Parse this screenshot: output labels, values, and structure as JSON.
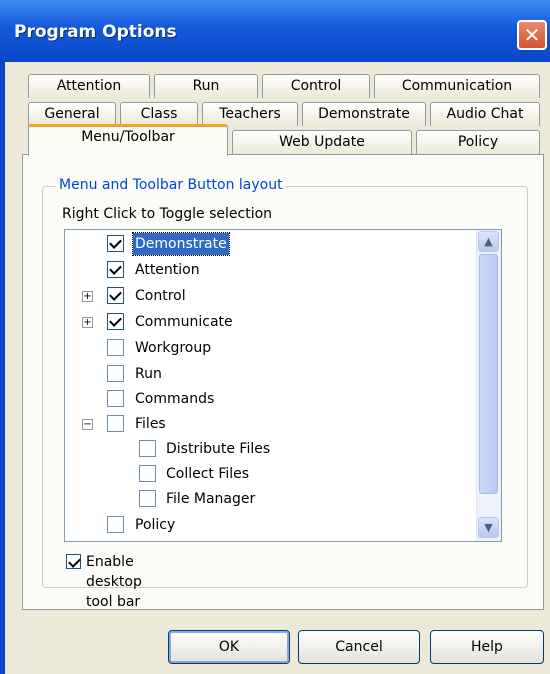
{
  "window": {
    "title": "Program Options",
    "close_label": "✕"
  },
  "tabs": {
    "row1": [
      "Attention",
      "Run",
      "Control",
      "Communication"
    ],
    "row2": [
      "General",
      "Class",
      "Teachers",
      "Demonstrate",
      "Audio Chat"
    ],
    "row3": [
      "Menu/Toolbar",
      "Web Update",
      "Policy"
    ],
    "active": "Menu/Toolbar"
  },
  "group": {
    "title": "Menu and Toolbar Button layout",
    "hint": "Right Click to Toggle selection"
  },
  "tree": [
    {
      "label": "Demonstrate",
      "checked": true,
      "selected": true,
      "expander": "",
      "level": 0
    },
    {
      "label": "Attention",
      "checked": true,
      "selected": false,
      "expander": "",
      "level": 0
    },
    {
      "label": "Control",
      "checked": true,
      "selected": false,
      "expander": "+",
      "level": 0
    },
    {
      "label": "Communicate",
      "checked": true,
      "selected": false,
      "expander": "+",
      "level": 0
    },
    {
      "label": "Workgroup",
      "checked": false,
      "selected": false,
      "expander": "",
      "level": 0
    },
    {
      "label": "Run",
      "checked": false,
      "selected": false,
      "expander": "",
      "level": 0
    },
    {
      "label": "Commands",
      "checked": false,
      "selected": false,
      "expander": "",
      "level": 0
    },
    {
      "label": "Files",
      "checked": false,
      "selected": false,
      "expander": "−",
      "level": 0
    },
    {
      "label": "Distribute Files",
      "checked": false,
      "selected": false,
      "expander": "",
      "level": 1
    },
    {
      "label": "Collect Files",
      "checked": false,
      "selected": false,
      "expander": "",
      "level": 1
    },
    {
      "label": "File Manager",
      "checked": false,
      "selected": false,
      "expander": "",
      "level": 1
    },
    {
      "label": "Policy",
      "checked": false,
      "selected": false,
      "expander": "",
      "level": 0
    }
  ],
  "desktop_toolbar": {
    "label": "Enable desktop tool bar",
    "checked": true
  },
  "buttons": {
    "ok": "OK",
    "cancel": "Cancel",
    "help": "Help"
  },
  "colors": {
    "title_bar": "#0a47c8",
    "selection": "#316ac5",
    "group_title": "#0046d5",
    "tab_highlight": "#f0a030"
  }
}
